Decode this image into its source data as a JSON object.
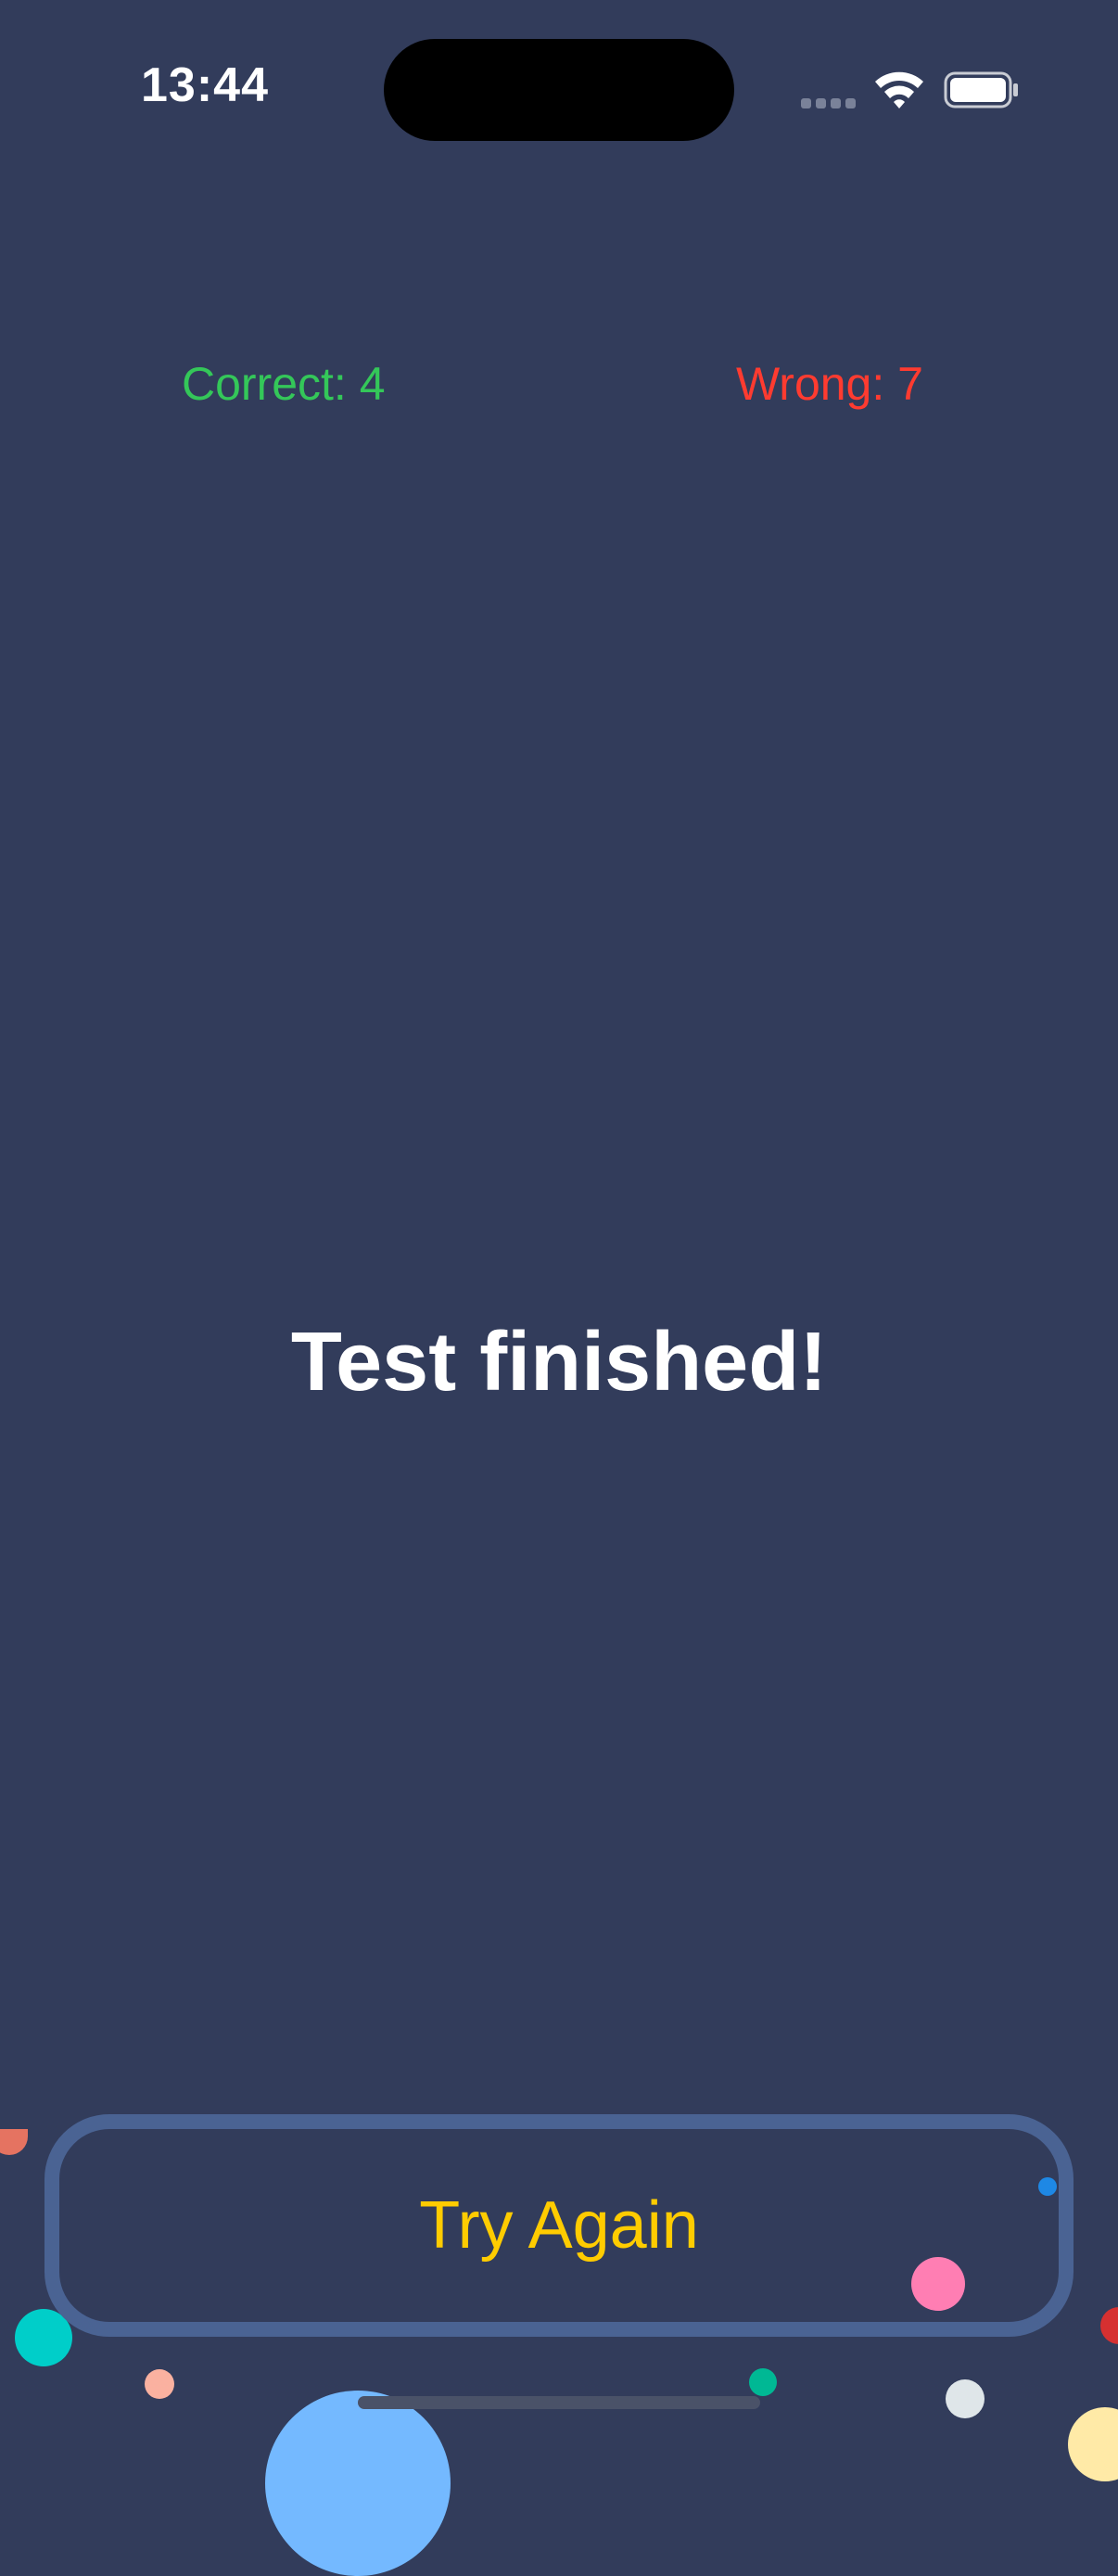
{
  "status_bar": {
    "time": "13:44",
    "icons": [
      "cellular-signal-icon",
      "wifi-icon",
      "battery-icon"
    ]
  },
  "score": {
    "correct_label": "Correct: 4",
    "wrong_label": "Wrong: 7",
    "correct": 4,
    "wrong": 7
  },
  "result": {
    "title": "Test finished!"
  },
  "actions": {
    "try_again_label": "Try Again"
  },
  "colors": {
    "background": "#323c5b",
    "correct": "#34c759",
    "wrong": "#ff3b30",
    "button_border": "#4a6393",
    "button_text": "#ffcc00"
  }
}
